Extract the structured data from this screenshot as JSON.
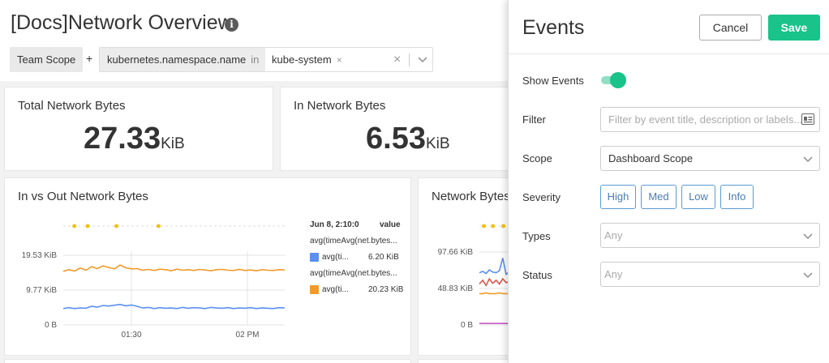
{
  "dashboard": {
    "title": "[Docs]Network Overview",
    "info_glyph": "i",
    "scope_label": "Team Scope",
    "plus": "+",
    "filter": {
      "key": "kubernetes.namespace.name",
      "operator": "in",
      "value": "kube-system",
      "value_remove": "×",
      "clear": "×"
    }
  },
  "panels": {
    "total_network": {
      "title": "Total Network Bytes",
      "value": "27.33",
      "unit": "KiB"
    },
    "in_network": {
      "title": "In Network Bytes",
      "value": "6.53",
      "unit": "KiB"
    },
    "in_vs_out": {
      "title": "In vs Out Network Bytes",
      "legend_header_time": "Jun 8, 2:10:0",
      "legend_header_value": "value",
      "legend": [
        {
          "query": "avg(timeAvg(net.bytes...",
          "name": "avg(ti...",
          "value": "6.20 KiB",
          "color": "#5b8ff0"
        },
        {
          "query": "avg(timeAvg(net.bytes...",
          "name": "avg(ti...",
          "value": "20.23 KiB",
          "color": "#f19a2b"
        }
      ]
    },
    "network_bytes": {
      "title": "Network Bytes"
    }
  },
  "chart_data": [
    {
      "type": "line",
      "title": "In vs Out Network Bytes",
      "x_ticks": [
        "01:30",
        "02 PM"
      ],
      "y_ticks": [
        "0 B",
        "9.77 KiB",
        "19.53 KiB"
      ],
      "ylim": [
        0,
        24
      ],
      "y_unit": "KiB",
      "series": [
        {
          "name": "avg(ti...",
          "color": "#f19a2b",
          "values": [
            19.6,
            20.2,
            19.7,
            20.8,
            20.0,
            21.3,
            20.6,
            21.6,
            21.0,
            20.5,
            21.9,
            20.9,
            20.5,
            20.6,
            20.0,
            20.3,
            19.9,
            20.4,
            20.2,
            19.8,
            20.4,
            20.0,
            20.2,
            19.9,
            20.3,
            20.1,
            19.8,
            20.2,
            20.3,
            20.0,
            19.9,
            20.3,
            19.9,
            20.1,
            19.8,
            20.2,
            20.0,
            19.9,
            20.2,
            20.1
          ]
        },
        {
          "name": "avg(ti...",
          "color": "#5b8ff0",
          "values": [
            6.0,
            6.3,
            6.0,
            6.2,
            6.1,
            6.8,
            6.5,
            7.1,
            6.9,
            7.2,
            7.5,
            7.0,
            7.3,
            6.8,
            6.2,
            6.4,
            6.0,
            6.3,
            6.1,
            6.2,
            6.0,
            6.4,
            6.1,
            6.3,
            6.2,
            6.0,
            6.4,
            6.2,
            6.1,
            6.3,
            6.0,
            6.2,
            6.1,
            6.3,
            6.0,
            6.2,
            6.1,
            6.0,
            6.3,
            6.2
          ]
        }
      ],
      "event_markers": [
        0.05,
        0.11,
        0.24,
        0.43
      ],
      "grid": true
    },
    {
      "type": "line",
      "title": "Network Bytes",
      "y_ticks": [
        "0 B",
        "48.83 KiB",
        "97.66 KiB"
      ],
      "ylim": [
        0,
        110
      ],
      "y_unit": "KiB",
      "series": [
        {
          "color": "#5b8ff0",
          "values": [
            70,
            72,
            69,
            74,
            71,
            70,
            73,
            90,
            68,
            72
          ]
        },
        {
          "color": "#e0554a",
          "values": [
            55,
            60,
            53,
            62,
            56,
            60,
            55,
            62,
            57,
            58
          ]
        },
        {
          "color": "#f19a2b",
          "values": [
            42,
            42,
            43,
            42,
            42,
            42,
            43,
            42,
            42,
            42
          ]
        },
        {
          "color": "#c65cc1",
          "values": [
            2,
            2,
            2,
            2,
            2,
            2,
            2,
            2,
            2,
            2
          ]
        }
      ],
      "event_markers": [
        0.15,
        0.45,
        0.8
      ]
    }
  ],
  "events_panel": {
    "title": "Events",
    "cancel_label": "Cancel",
    "save_label": "Save",
    "show_events_label": "Show Events",
    "show_events_on": true,
    "filter_label": "Filter",
    "filter_placeholder": "Filter by event title, description or labels...",
    "scope_label": "Scope",
    "scope_value": "Dashboard Scope",
    "severity_label": "Severity",
    "severity_options": [
      "High",
      "Med",
      "Low",
      "Info"
    ],
    "types_label": "Types",
    "types_placeholder": "Any",
    "status_label": "Status",
    "status_placeholder": "Any",
    "accent_color": "#19c38a"
  }
}
